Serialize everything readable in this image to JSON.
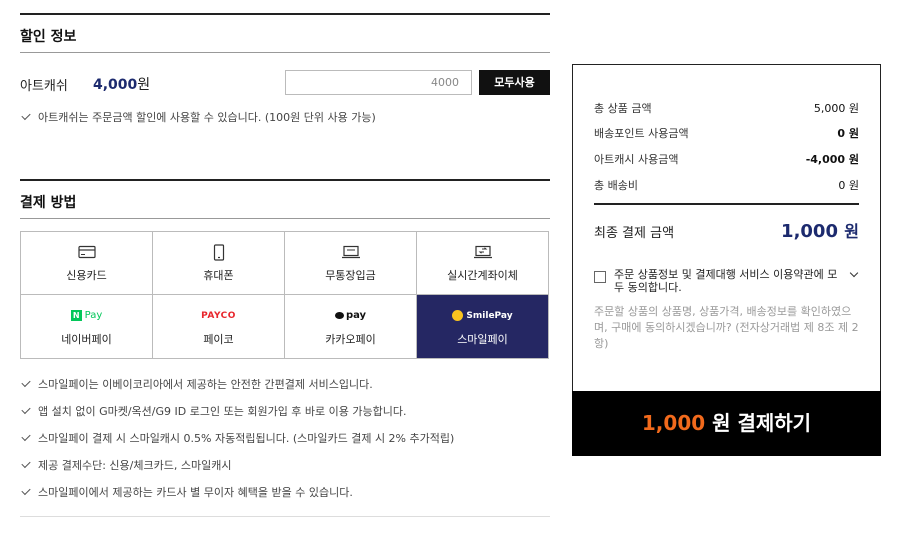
{
  "discount": {
    "section_title": "할인 정보",
    "artcash_label": "아트캐쉬",
    "artcash_amount": "4,000",
    "artcash_unit": "원",
    "input_value": "4000",
    "use_all_button": "모두사용",
    "note": "아트캐쉬는 주문금액 할인에 사용할 수 있습니다. (100원 단위 사용 가능)"
  },
  "payment": {
    "section_title": "결제 방법",
    "methods": [
      {
        "label": "신용카드",
        "icon": "credit-card-icon"
      },
      {
        "label": "휴대폰",
        "icon": "mobile-phone-icon"
      },
      {
        "label": "무통장입금",
        "icon": "bank-deposit-icon"
      },
      {
        "label": "실시간계좌이체",
        "icon": "bank-transfer-icon"
      },
      {
        "label": "네이버페이",
        "logo": "N Pay"
      },
      {
        "label": "페이코",
        "logo": "PAYCO"
      },
      {
        "label": "카카오페이",
        "logo": "pay"
      },
      {
        "label": "스마일페이",
        "logo": "SmilePay",
        "selected": true
      }
    ],
    "notes": [
      "스마일페이는 이베이코리아에서 제공하는 안전한 간편결제 서비스입니다.",
      "앱 설치 없이 G마켓/옥션/G9 ID 로그인 또는 회원가입 후 바로 이용 가능합니다.",
      "스마일페이 결제 시 스마일캐시 0.5% 자동적립됩니다. (스마일카드 결제 시 2% 추가적립)",
      "제공 결제수단: 신용/체크카드, 스마일캐시",
      "스마일페이에서 제공하는 카드사 별 무이자 혜택을 받을 수 있습니다."
    ]
  },
  "summary": {
    "rows": [
      {
        "label": "총 상품 금액",
        "value": "5,000 원"
      },
      {
        "label": "배송포인트 사용금액",
        "value": "0 원"
      },
      {
        "label": "아트캐시 사용금액",
        "value": "-4,000 원"
      },
      {
        "label": "총 배송비",
        "value": "0 원"
      }
    ],
    "final_label": "최종 결제 금액",
    "final_value": "1,000",
    "final_unit": "원",
    "agree_text": "주문 상품정보 및 결제대행 서비스 이용약관에 모두 동의합니다.",
    "info_text": "주문할 상품의 상품명, 상품가격, 배송정보를 확인하였으며, 구매에 동의하시겠습니까? (전자상거래법 제 8조 제 2항)",
    "pay_amount": "1,000",
    "pay_label": " 원 결제하기"
  },
  "colors": {
    "accent_navy": "#1c2a6e",
    "selected_bg": "#252763",
    "pay_amount": "#f26a1c",
    "naver_green": "#03c75a",
    "payco_red": "#e8262c",
    "smile_yellow": "#f9c31f"
  }
}
